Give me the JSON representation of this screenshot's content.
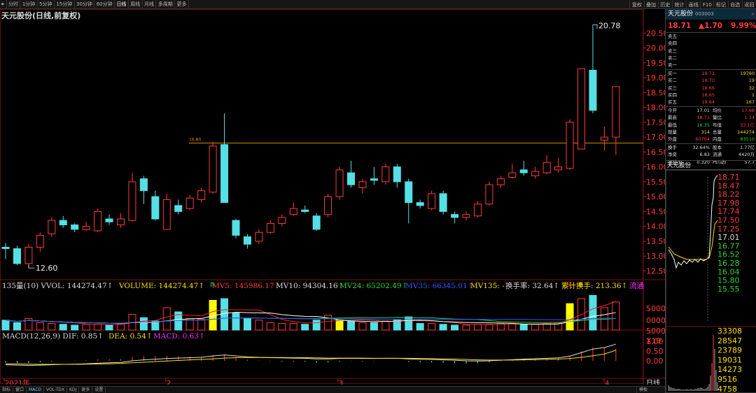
{
  "toolbar": {
    "left": [
      "分时",
      "1分钟",
      "5分钟",
      "15分钟",
      "30分钟",
      "60分钟",
      "日线",
      "周线",
      "月线",
      "多周期",
      "更多"
    ],
    "active": "日线",
    "left_arrow": "▶",
    "right": [
      "复权",
      "叠加",
      "历史",
      "统计",
      "画线",
      "F10",
      "标记",
      "自选",
      "返回"
    ]
  },
  "chart_title": "天元股份(日线,前复权)",
  "axis_y_labels": [
    "20.50",
    "20.00",
    "19.50",
    "19.00",
    "18.50",
    "18.00",
    "17.50",
    "17.00",
    "16.50",
    "16.00",
    "15.50",
    "15.00",
    "14.50",
    "14.00",
    "13.50",
    "13.00",
    "12.50"
  ],
  "annotations": {
    "high": "20.78",
    "low": "12.60",
    "level": "16.80"
  },
  "volume_header": {
    "a": "135量(10) VVOL: 144274.47↑",
    "b": "VOLUME: 144274.47↑",
    "c": "MV5: 145986.17↑",
    "d": "MV10: 94304.16↑",
    "e": "MV24: 65202.49↑",
    "f": "MV35: 66345.01↑",
    "g": "MV135: -",
    "h": "换手率: 32.64↑",
    "i": "累计换手: 213.36↑",
    "j": "流通"
  },
  "volume_axis": [
    "5000",
    "0000",
    "5000",
    "X10"
  ],
  "markers": {
    "m1": "跌",
    "m2": "涨",
    "m3": "跌"
  },
  "macd_header": {
    "a": "MACD(12,26,9) DIF: 0.85↑",
    "b": "DEA: 0.54↑",
    "c": "MACD: 0.63↑"
  },
  "macd_axis": [
    "1.00",
    "0.50",
    "0.00"
  ],
  "date_labels": {
    "start": "2021年",
    "m2": "2",
    "m3": "3",
    "m4": "4"
  },
  "period_label": "日线",
  "bottom_tabs": [
    "指标",
    "窗口",
    "MACD",
    "VOL-TDX",
    "KDJ",
    "更多",
    "设置"
  ],
  "bottom_right": "模板",
  "colors": {
    "up": "#ff3b3b",
    "down": "#54e0e6",
    "ma5": "#ffffff",
    "ma10": "#ffe000",
    "vol_ma": "#ff2020",
    "level": "#d98c00"
  },
  "chart_data": {
    "type": "candlestick",
    "title": "天元股份(日线,前复权)",
    "ylim": [
      12.3,
      21.0
    ],
    "price_line": 16.8,
    "candles": [
      {
        "o": 13.3,
        "c": 13.25,
        "h": 13.45,
        "l": 12.9
      },
      {
        "o": 13.25,
        "c": 12.75,
        "h": 13.35,
        "l": 12.7
      },
      {
        "o": 12.75,
        "c": 13.3,
        "h": 13.4,
        "l": 12.6
      },
      {
        "o": 13.3,
        "c": 13.7,
        "h": 13.8,
        "l": 13.15
      },
      {
        "o": 13.75,
        "c": 14.2,
        "h": 14.3,
        "l": 13.65
      },
      {
        "o": 14.2,
        "c": 14.05,
        "h": 14.35,
        "l": 13.95
      },
      {
        "o": 14.05,
        "c": 13.9,
        "h": 14.1,
        "l": 13.8
      },
      {
        "o": 13.9,
        "c": 14.0,
        "h": 14.15,
        "l": 13.85
      },
      {
        "o": 13.85,
        "c": 14.5,
        "h": 14.6,
        "l": 13.8
      },
      {
        "o": 14.25,
        "c": 14.15,
        "h": 14.4,
        "l": 14.05
      },
      {
        "o": 14.05,
        "c": 14.25,
        "h": 14.45,
        "l": 13.95
      },
      {
        "o": 14.2,
        "c": 15.5,
        "h": 15.8,
        "l": 14.15
      },
      {
        "o": 15.6,
        "c": 15.2,
        "h": 15.7,
        "l": 14.75
      },
      {
        "o": 15.0,
        "c": 14.25,
        "h": 15.2,
        "l": 14.2
      },
      {
        "o": 13.9,
        "c": 14.9,
        "h": 15.1,
        "l": 13.9
      },
      {
        "o": 14.7,
        "c": 14.5,
        "h": 14.9,
        "l": 14.4
      },
      {
        "o": 14.6,
        "c": 14.95,
        "h": 15.05,
        "l": 14.55
      },
      {
        "o": 14.9,
        "c": 15.2,
        "h": 15.3,
        "l": 14.8
      },
      {
        "o": 15.15,
        "c": 16.7,
        "h": 16.85,
        "l": 15.1
      },
      {
        "o": 16.75,
        "c": 14.8,
        "h": 17.8,
        "l": 14.8
      },
      {
        "o": 14.2,
        "c": 13.7,
        "h": 14.25,
        "l": 13.6
      },
      {
        "o": 13.65,
        "c": 13.4,
        "h": 13.75,
        "l": 13.25
      },
      {
        "o": 13.5,
        "c": 13.8,
        "h": 13.9,
        "l": 13.4
      },
      {
        "o": 13.8,
        "c": 14.1,
        "h": 14.2,
        "l": 13.75
      },
      {
        "o": 14.1,
        "c": 14.3,
        "h": 14.4,
        "l": 14.0
      },
      {
        "o": 14.4,
        "c": 14.6,
        "h": 14.8,
        "l": 14.35
      },
      {
        "o": 14.55,
        "c": 14.5,
        "h": 14.7,
        "l": 14.45
      },
      {
        "o": 14.35,
        "c": 13.9,
        "h": 14.45,
        "l": 13.85
      },
      {
        "o": 14.4,
        "c": 15.0,
        "h": 15.1,
        "l": 14.3
      },
      {
        "o": 15.0,
        "c": 15.9,
        "h": 16.0,
        "l": 14.9
      },
      {
        "o": 15.8,
        "c": 15.4,
        "h": 16.2,
        "l": 15.3
      },
      {
        "o": 15.3,
        "c": 15.5,
        "h": 15.6,
        "l": 15.1
      },
      {
        "o": 15.6,
        "c": 15.55,
        "h": 16.0,
        "l": 15.4
      },
      {
        "o": 15.5,
        "c": 16.0,
        "h": 16.1,
        "l": 15.4
      },
      {
        "o": 16.0,
        "c": 15.5,
        "h": 16.1,
        "l": 15.3
      },
      {
        "o": 15.5,
        "c": 14.8,
        "h": 15.6,
        "l": 14.1
      },
      {
        "o": 14.8,
        "c": 14.7,
        "h": 14.9,
        "l": 14.6
      },
      {
        "o": 14.6,
        "c": 15.1,
        "h": 15.2,
        "l": 14.55
      },
      {
        "o": 15.1,
        "c": 14.5,
        "h": 15.2,
        "l": 14.4
      },
      {
        "o": 14.4,
        "c": 14.3,
        "h": 14.5,
        "l": 14.1
      },
      {
        "o": 14.3,
        "c": 14.4,
        "h": 14.5,
        "l": 14.2
      },
      {
        "o": 14.35,
        "c": 14.75,
        "h": 14.85,
        "l": 14.3
      },
      {
        "o": 14.75,
        "c": 15.4,
        "h": 15.5,
        "l": 14.7
      },
      {
        "o": 15.4,
        "c": 15.6,
        "h": 15.7,
        "l": 15.3
      },
      {
        "o": 15.65,
        "c": 15.8,
        "h": 16.1,
        "l": 15.6
      },
      {
        "o": 15.9,
        "c": 15.8,
        "h": 16.2,
        "l": 15.7
      },
      {
        "o": 15.7,
        "c": 15.85,
        "h": 16.0,
        "l": 15.6
      },
      {
        "o": 15.8,
        "c": 16.15,
        "h": 16.4,
        "l": 15.75
      },
      {
        "o": 15.9,
        "c": 16.0,
        "h": 16.3,
        "l": 15.8
      },
      {
        "o": 15.95,
        "c": 17.5,
        "h": 17.6,
        "l": 15.9
      },
      {
        "o": 16.6,
        "c": 19.3,
        "h": 19.3,
        "l": 16.6
      },
      {
        "o": 19.25,
        "c": 17.9,
        "h": 20.78,
        "l": 17.8
      },
      {
        "o": 16.9,
        "c": 17.0,
        "h": 17.35,
        "l": 16.55
      },
      {
        "o": 17.0,
        "c": 18.7,
        "h": 18.71,
        "l": 16.4
      }
    ],
    "volume": [
      60,
      45,
      70,
      45,
      40,
      35,
      30,
      35,
      35,
      30,
      35,
      95,
      75,
      55,
      135,
      110,
      70,
      65,
      180,
      190,
      105,
      70,
      60,
      45,
      40,
      40,
      35,
      60,
      90,
      60,
      55,
      45,
      45,
      55,
      60,
      80,
      40,
      40,
      35,
      30,
      30,
      35,
      35,
      40,
      40,
      35,
      35,
      40,
      45,
      160,
      190,
      210,
      135,
      170
    ],
    "macd_dif": [
      -0.2,
      -0.22,
      -0.23,
      -0.22,
      -0.2,
      -0.18,
      -0.17,
      -0.15,
      -0.12,
      -0.1,
      -0.08,
      0.0,
      0.05,
      0.08,
      0.12,
      0.14,
      0.16,
      0.18,
      0.25,
      0.3,
      0.25,
      0.2,
      0.18,
      0.16,
      0.15,
      0.14,
      0.13,
      0.1,
      0.1,
      0.12,
      0.13,
      0.12,
      0.12,
      0.13,
      0.13,
      0.1,
      0.08,
      0.07,
      0.05,
      0.03,
      0.0,
      -0.01,
      0.0,
      0.03,
      0.06,
      0.09,
      0.11,
      0.13,
      0.15,
      0.24,
      0.42,
      0.6,
      0.68,
      0.85
    ],
    "macd_dea": [
      -0.15,
      -0.16,
      -0.17,
      -0.18,
      -0.18,
      -0.18,
      -0.18,
      -0.17,
      -0.16,
      -0.15,
      -0.13,
      -0.1,
      -0.07,
      -0.04,
      -0.01,
      0.02,
      0.05,
      0.07,
      0.1,
      0.14,
      0.16,
      0.17,
      0.17,
      0.17,
      0.17,
      0.16,
      0.16,
      0.15,
      0.14,
      0.14,
      0.14,
      0.14,
      0.13,
      0.13,
      0.13,
      0.13,
      0.12,
      0.11,
      0.1,
      0.09,
      0.07,
      0.05,
      0.04,
      0.04,
      0.04,
      0.05,
      0.06,
      0.08,
      0.09,
      0.12,
      0.18,
      0.26,
      0.35,
      0.54
    ]
  },
  "sidebar": {
    "name": "天元股份",
    "code": "003003",
    "x": "×",
    "price": "18.71",
    "change": "▲1.70",
    "pct": "9.99%",
    "asks": [
      {
        "l": "卖五",
        "p": "",
        "v": ""
      },
      {
        "l": "卖四",
        "p": "",
        "v": ""
      },
      {
        "l": "卖三",
        "p": "",
        "v": ""
      },
      {
        "l": "卖二",
        "p": "",
        "v": ""
      },
      {
        "l": "卖一",
        "p": "",
        "v": ""
      }
    ],
    "bids": [
      {
        "l": "买一",
        "p": "18.71",
        "v": "19760"
      },
      {
        "l": "买二",
        "p": "18.70",
        "v": "19"
      },
      {
        "l": "买三",
        "p": "18.66",
        "v": "32"
      },
      {
        "l": "买四",
        "p": "18.65",
        "v": "1"
      },
      {
        "l": "买五",
        "p": "18.64",
        "v": "167"
      }
    ],
    "stats": [
      {
        "a": "今开",
        "b": "17.01",
        "c": "均价",
        "d": "17.68"
      },
      {
        "a": "最高",
        "b": "18.71",
        "c": "量比",
        "d": "1.14"
      },
      {
        "a": "最低",
        "b": "16.35",
        "c": "市值",
        "d": "33.1亿"
      },
      {
        "a": "现量",
        "b": "314",
        "c": "总量",
        "d": "144274"
      },
      {
        "a": "外盘",
        "b": "60764",
        "c": "内盘",
        "d": "83510"
      }
    ],
    "stats2": [
      {
        "a": "换手",
        "b": "32.64%",
        "c": "股本",
        "d": "1.77亿"
      },
      {
        "a": "净资",
        "b": "6.83",
        "c": "流通",
        "d": "4420万"
      },
      {
        "a": "收益(t)",
        "b": "0.320",
        "c": "PE(动)",
        "d": "57.7"
      }
    ],
    "mini_title": "天元股份",
    "mini_axis": [
      "18.71",
      "18.47",
      "18.22",
      "17.98",
      "17.74",
      "17.50",
      "17.25",
      "17.01",
      "16.77",
      "16.52",
      "16.28",
      "16.04",
      "15.80",
      "15.55",
      "33308",
      "28547",
      "23789",
      "19031",
      "14273",
      "9516",
      "4758"
    ]
  }
}
